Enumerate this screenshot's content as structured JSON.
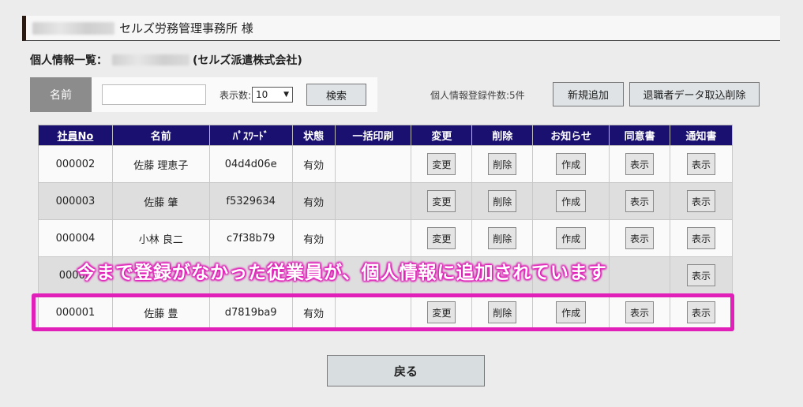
{
  "header": {
    "office_name": "セルズ労務管理事務所 様"
  },
  "list_title": {
    "prefix": "個人情報一覧：",
    "company": "(セルズ派遣株式会社)"
  },
  "search": {
    "name_label": "名前",
    "name_value": "",
    "count_label": "表示数:",
    "count_value": "10",
    "search_button": "検索"
  },
  "registration_count": "個人情報登録件数:5件",
  "buttons": {
    "new": "新規追加",
    "retire": "退職者データ取込削除",
    "back": "戻る"
  },
  "table": {
    "headers": [
      "社員No",
      "名前",
      "ﾊﾟｽﾜｰﾄﾞ",
      "状態",
      "一括印刷",
      "変更",
      "削除",
      "お知らせ",
      "同意書",
      "通知書"
    ],
    "rows": [
      {
        "no": "000002",
        "name": "佐藤 理恵子",
        "password": "04d4d06e",
        "status": "有効",
        "edit": "変更",
        "delete": "削除",
        "notice": "作成",
        "consent": "表示",
        "notification": "表示"
      },
      {
        "no": "000003",
        "name": "佐藤 肇",
        "password": "f5329634",
        "status": "有効",
        "edit": "変更",
        "delete": "削除",
        "notice": "作成",
        "consent": "表示",
        "notification": "表示"
      },
      {
        "no": "000004",
        "name": "小林 良二",
        "password": "c7f38b79",
        "status": "有効",
        "edit": "変更",
        "delete": "削除",
        "notice": "作成",
        "consent": "表示",
        "notification": "表示"
      },
      {
        "no": "00000",
        "name": "",
        "password": "",
        "status": "",
        "edit": "",
        "delete": "",
        "notice": "",
        "consent": "",
        "notification": "表示"
      },
      {
        "no": "000001",
        "name": "佐藤 豊",
        "password": "d7819ba9",
        "status": "有効",
        "edit": "変更",
        "delete": "削除",
        "notice": "作成",
        "consent": "表示",
        "notification": "表示"
      }
    ]
  },
  "annotation": "今まで登録がなかった従業員が、個人情報に追加されています",
  "colors": {
    "header_bg": "#1a1070",
    "highlight": "#e020b8"
  }
}
